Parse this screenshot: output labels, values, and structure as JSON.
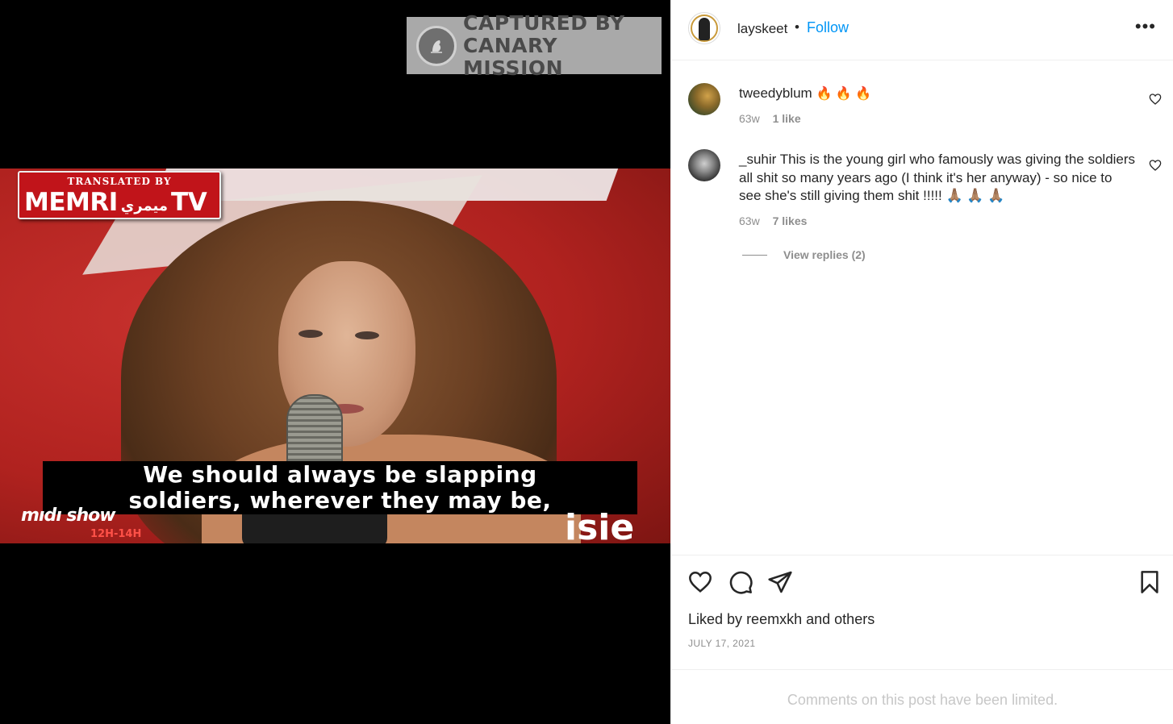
{
  "watermark": {
    "line1": "CAPTURED BY",
    "line2": "CANARY MISSION"
  },
  "video": {
    "badge_top": "TRANSLATED BY",
    "badge_main": "MEMRI",
    "badge_arabic": "ميمري",
    "badge_tv": "TV",
    "subtitle_line1": "We should always be slapping",
    "subtitle_line2": "soldiers, wherever they may be,",
    "show_logo": "mıdı show",
    "show_time": "12H-14H",
    "frame_word": "isie"
  },
  "header": {
    "username": "layskeet",
    "separator": "•",
    "follow_label": "Follow",
    "more_label": "•••"
  },
  "comments": [
    {
      "username": "tweedyblum",
      "text": "🔥 🔥 🔥",
      "age": "63w",
      "likes": "1 like"
    },
    {
      "username": "_suhir",
      "text": "This is the young girl who famously was giving the soldiers all shit so many years ago (I think it's her anyway) - so nice to see she's still giving them shit !!!!! 🙏🏽 🙏🏽 🙏🏽",
      "age": "63w",
      "likes": "7 likes",
      "view_replies": "View replies (2)"
    }
  ],
  "actions": {
    "liked_prefix": "Liked by",
    "liked_user": "reemxkh",
    "liked_and": "and",
    "liked_others": "others",
    "date": "JULY 17, 2021"
  },
  "footer": {
    "limited_text": "Comments on this post have been limited."
  },
  "colors": {
    "accent": "#0095f6",
    "muted": "#8e8e8e",
    "text": "#262626"
  }
}
